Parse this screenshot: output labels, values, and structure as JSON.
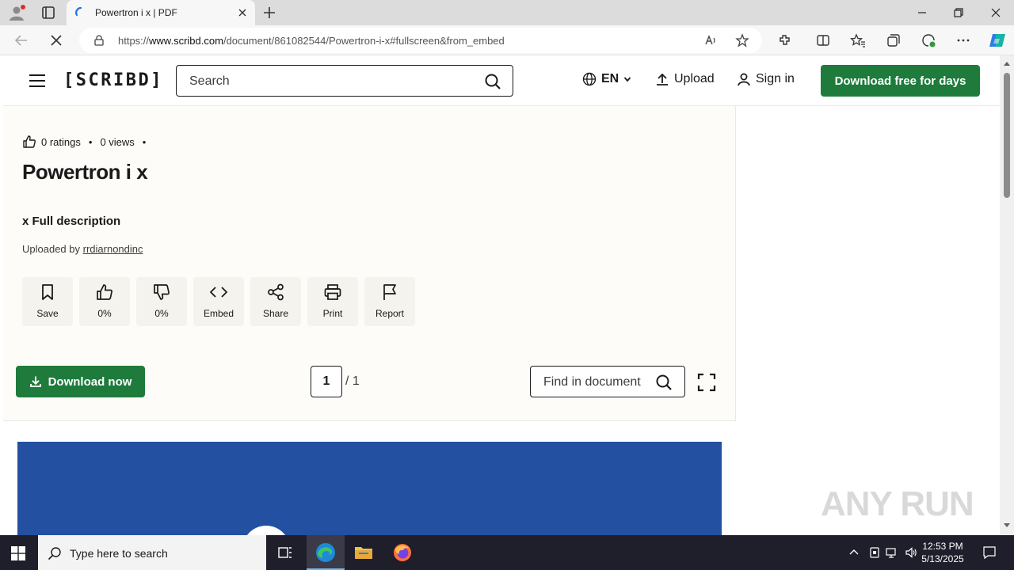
{
  "browser": {
    "tab_title": "Powertron i x | PDF",
    "url_prefix": "https://",
    "url_domain": "www.scribd.com",
    "url_path": "/document/861082544/Powertron-i-x#fullscreen&from_embed"
  },
  "header": {
    "logo": "[SCRIBD]",
    "search_placeholder": "Search",
    "language": "EN",
    "upload_label": "Upload",
    "signin_label": "Sign in",
    "download_free_label": "Download free for days"
  },
  "document": {
    "ratings": "0 ratings",
    "views": "0 views",
    "title": "Powertron i x",
    "description_heading": "x Full description",
    "uploaded_by_prefix": "Uploaded by",
    "uploader": "rrdiarnondinc",
    "actions": [
      {
        "label": "Save",
        "icon": "bookmark-icon"
      },
      {
        "label": "0%",
        "icon": "thumbs-up-icon"
      },
      {
        "label": "0%",
        "icon": "thumbs-down-icon"
      },
      {
        "label": "Embed",
        "icon": "code-icon"
      },
      {
        "label": "Share",
        "icon": "share-icon"
      },
      {
        "label": "Print",
        "icon": "printer-icon"
      },
      {
        "label": "Report",
        "icon": "flag-icon"
      }
    ],
    "download_now_label": "Download now",
    "current_page": "1",
    "total_pages": "/ 1",
    "find_placeholder": "Find in document"
  },
  "watermark": "ANY RUN",
  "taskbar": {
    "search_placeholder": "Type here to search",
    "time": "12:53 PM",
    "date": "5/13/2025"
  },
  "colors": {
    "brand_green": "#1e7b3c",
    "preview_blue": "#2350a1",
    "page_bg": "#fdfcf8"
  }
}
